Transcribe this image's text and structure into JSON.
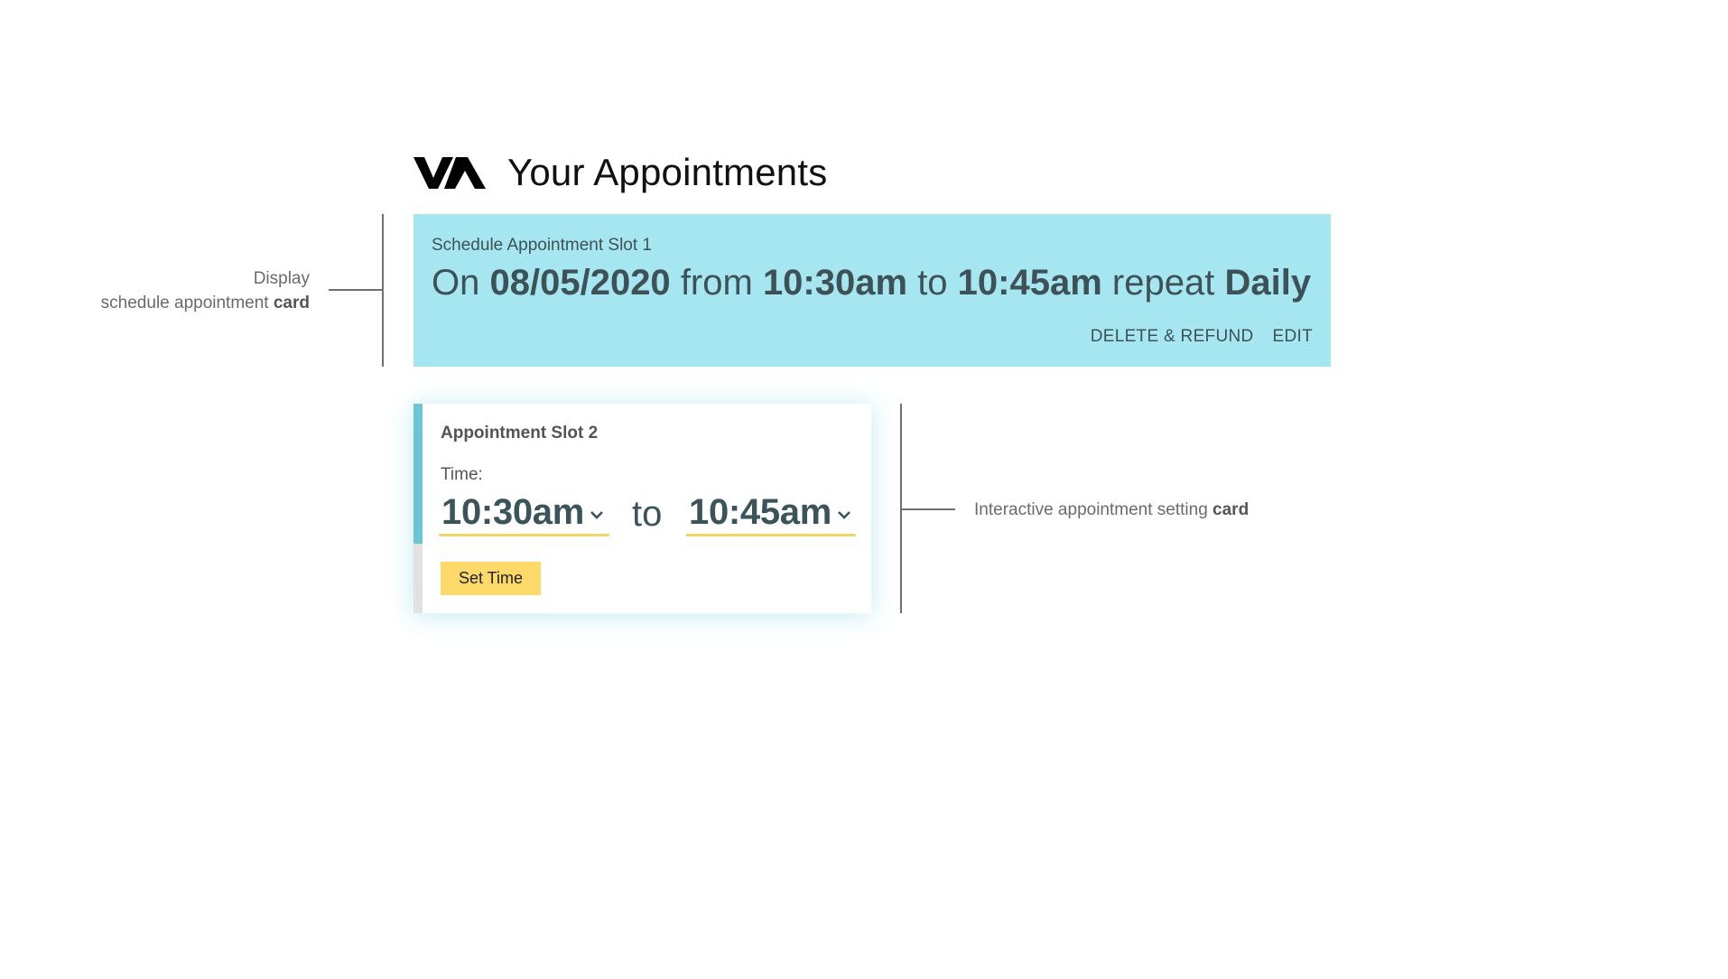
{
  "header": {
    "logo_text": "VA",
    "title": "Your Appointments"
  },
  "annotations": {
    "display_line1": "Display",
    "display_line2_prefix": "schedule appointment ",
    "display_line2_bold": "card",
    "interactive_prefix": "Interactive appointment setting ",
    "interactive_bold": "card"
  },
  "card1": {
    "title": "Schedule Appointment Slot 1",
    "summary": {
      "on_word": "On",
      "date": "08/05/2020",
      "from_word": "from",
      "start_time": "10:30am",
      "to_word": "to",
      "end_time": "10:45am",
      "repeat_word": "repeat",
      "frequency": "Daily"
    },
    "actions": {
      "delete_label": "DELETE & REFUND",
      "edit_label": "EDIT"
    }
  },
  "card2": {
    "title": "Appointment Slot 2",
    "time_label": "Time:",
    "start_time": "10:30am",
    "to_word": "to",
    "end_time": "10:45am",
    "set_button_label": "Set Time"
  },
  "colors": {
    "card1_background": "#a5e6f1",
    "card_text": "#3e5156",
    "rail_accent": "#6cc6d2",
    "rail_inactive": "#e1e1e1",
    "select_underline": "#f3d567",
    "button_yellow": "#fcd968"
  },
  "icons": {
    "logo": "va-logo",
    "dropdown": "chevron-down-icon"
  }
}
